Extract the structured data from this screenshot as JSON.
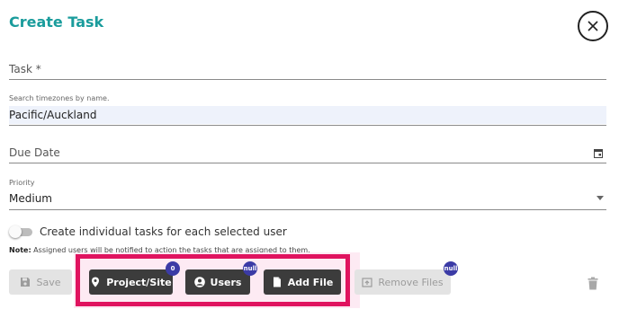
{
  "dialog": {
    "title": "Create Task"
  },
  "fields": {
    "task": {
      "label": "Task *",
      "value": ""
    },
    "timezone": {
      "label": "Search timezones by name.",
      "value": "Pacific/Auckland"
    },
    "due_date": {
      "label": "Due Date",
      "value": ""
    },
    "priority": {
      "label": "Priority",
      "value": "Medium"
    }
  },
  "toggle": {
    "label": "Create individual tasks for each selected user",
    "on": false
  },
  "note": {
    "prefix": "Note:",
    "text": " Assigned users will be notified to action the tasks that are assigned to them."
  },
  "buttons": {
    "save": "Save",
    "project_site": "Project/Site",
    "project_site_badge": "0",
    "users": "Users",
    "users_badge": "null",
    "add_file": "Add File",
    "remove_files": "Remove Files",
    "remove_files_badge": "null"
  },
  "colors": {
    "title": "#1a9c9c",
    "highlight": "#e0135f",
    "badge": "#3b3ba6",
    "dark_button": "#3c3c3c"
  },
  "icons": [
    "close-icon",
    "calendar-icon",
    "chevron-down-icon",
    "save-icon",
    "location-pin-icon",
    "user-circle-icon",
    "file-icon",
    "remove-file-icon",
    "trash-icon"
  ]
}
